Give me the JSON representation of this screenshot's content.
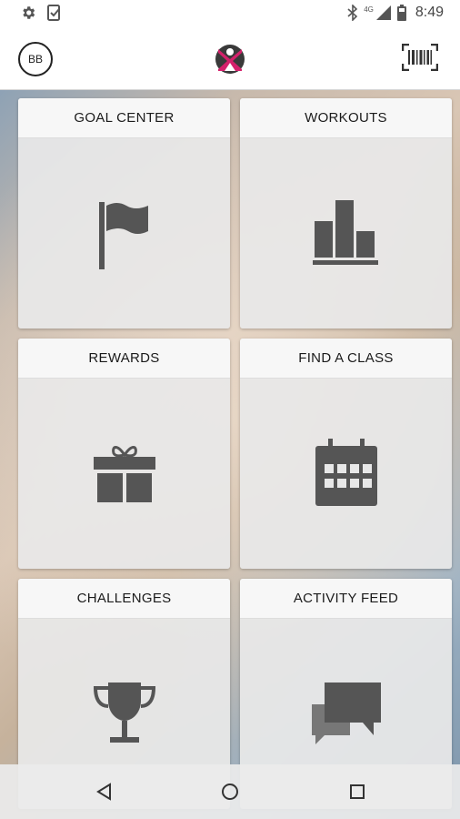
{
  "status_bar": {
    "time": "8:49",
    "network": "4G"
  },
  "app_bar": {
    "avatar_initials": "BB"
  },
  "tiles": [
    {
      "label": "GOAL CENTER",
      "icon": "flag-icon"
    },
    {
      "label": "WORKOUTS",
      "icon": "bar-chart-icon"
    },
    {
      "label": "REWARDS",
      "icon": "gift-icon"
    },
    {
      "label": "FIND A CLASS",
      "icon": "calendar-icon"
    },
    {
      "label": "CHALLENGES",
      "icon": "trophy-icon"
    },
    {
      "label": "ACTIVITY FEED",
      "icon": "chat-bubbles-icon"
    }
  ],
  "nav_bar": {
    "buttons": [
      "back-icon",
      "home-icon",
      "recents-icon"
    ]
  },
  "colors": {
    "icon_gray": "#555555",
    "logo_pink": "#d4216b",
    "logo_dark": "#3a3a3a"
  }
}
